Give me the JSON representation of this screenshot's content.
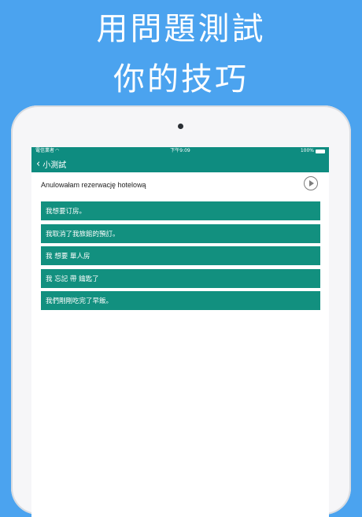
{
  "promo": {
    "line1": "用問題測試",
    "line2": "你的技巧"
  },
  "status_bar": {
    "carrier": "電信業者",
    "time": "下午9:09",
    "battery": "100%"
  },
  "nav": {
    "back_label": "小測試"
  },
  "question": {
    "text": "Anulowałam rezerwację hotelową"
  },
  "answers": [
    {
      "label": "我想要订房。"
    },
    {
      "label": "我取消了我旅館的預訂。"
    },
    {
      "label": "我 想要 單人房"
    },
    {
      "label": "我 忘記 帶 鑰匙了"
    },
    {
      "label": "我們剛剛吃完了早飯。"
    }
  ],
  "colors": {
    "background": "#4BA3EF",
    "accent": "#0E8C80",
    "answer": "#12907F"
  },
  "icons": {
    "back": "chevron-left-icon",
    "play": "play-circle-icon",
    "wifi": "wifi-icon",
    "battery": "battery-icon"
  }
}
